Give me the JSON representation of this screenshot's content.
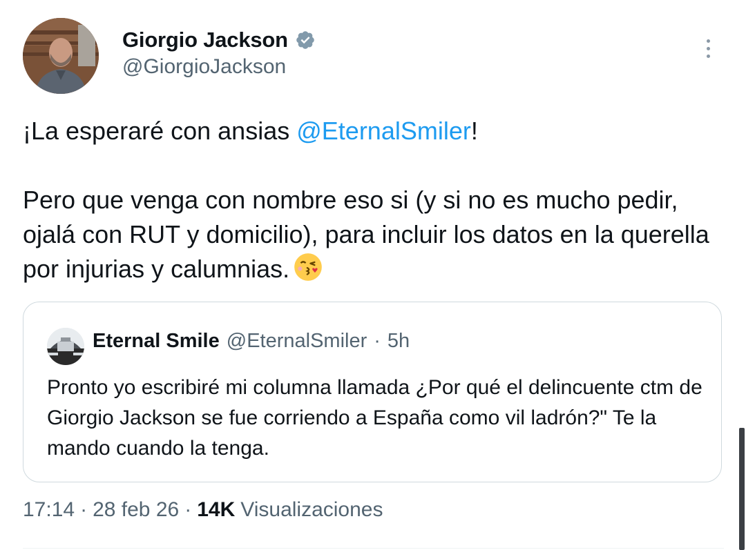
{
  "author": {
    "display_name": "Giorgio Jackson",
    "handle": "@GiorgioJackson",
    "verified_icon": "verified-badge-icon"
  },
  "tweet": {
    "line1_prefix": "¡La esperaré con ansias ",
    "line1_mention": "@EternalSmiler",
    "line1_suffix": "!",
    "paragraph2": "Pero que venga con nombre eso si (y si no es mucho pedir, ojalá con RUT y domicilio), para incluir los datos en la querella por injurias y calumnias.",
    "emoji": "face-blowing-kiss-emoji"
  },
  "quoted": {
    "display_name": "Eternal Smile",
    "handle": "@EternalSmiler",
    "separator": "·",
    "time": "5h",
    "text": "Pronto yo escribiré mi columna llamada ¿Por qué el delincuente ctm de Giorgio Jackson se fue corriendo a España como vil ladrón?\" Te la mando cuando la tenga."
  },
  "meta": {
    "time": "17:14",
    "sep1": "·",
    "date": "28 feb 26",
    "sep2": "·",
    "views_count": "14K",
    "views_label": "Visualizaciones"
  },
  "colors": {
    "accent": "#1d9bf0",
    "secondary_text": "#536471",
    "border": "#cfd9de"
  }
}
